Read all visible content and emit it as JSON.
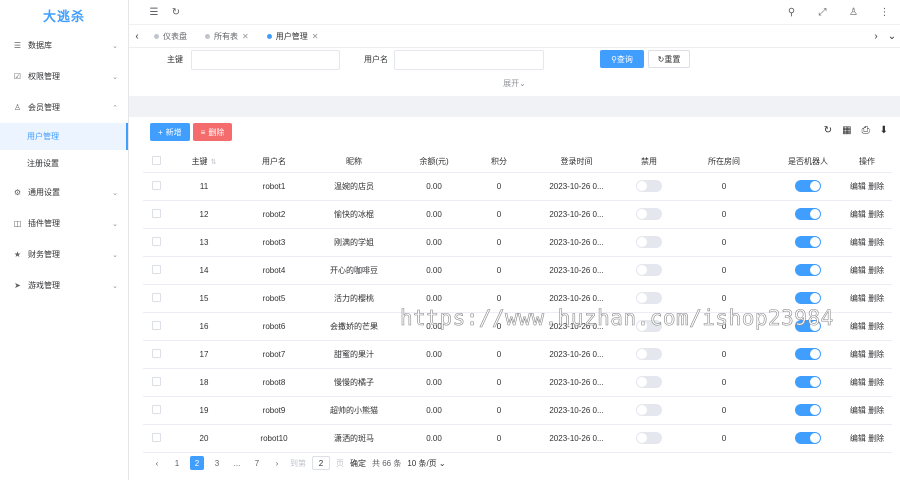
{
  "sidebar": {
    "logo": "大逃杀",
    "items": [
      {
        "label": "数据库",
        "icon": "database-icon"
      },
      {
        "label": "权限管理",
        "icon": "shield-icon"
      },
      {
        "label": "会员管理",
        "icon": "user-icon"
      },
      {
        "label": "用户管理",
        "icon": ""
      },
      {
        "label": "注册设置",
        "icon": ""
      },
      {
        "label": "通用设置",
        "icon": "gear-icon"
      },
      {
        "label": "插件管理",
        "icon": "plugin-icon"
      },
      {
        "label": "财务管理",
        "icon": "finance-icon"
      },
      {
        "label": "游戏管理",
        "icon": "send-icon"
      }
    ]
  },
  "tabs": [
    {
      "label": "仪表盘"
    },
    {
      "label": "所有表"
    },
    {
      "label": "用户管理"
    }
  ],
  "search": {
    "pk_label": "主键",
    "username_label": "用户名",
    "query_btn": "查询",
    "reset_btn": "重置",
    "expand": "展开"
  },
  "toolbar": {
    "add": "新增",
    "delete": "删除"
  },
  "table": {
    "headers": [
      "主键",
      "用户名",
      "昵称",
      "余额(元)",
      "积分",
      "登录时间",
      "禁用",
      "所在房间",
      "是否机器人",
      "操作"
    ],
    "rows": [
      {
        "id": "11",
        "username": "robot1",
        "nickname": "温婉的店员",
        "balance": "0.00",
        "points": "0",
        "login": "2023-10-26 0...",
        "room": "0"
      },
      {
        "id": "12",
        "username": "robot2",
        "nickname": "愉快的冰棍",
        "balance": "0.00",
        "points": "0",
        "login": "2023-10-26 0...",
        "room": "0"
      },
      {
        "id": "13",
        "username": "robot3",
        "nickname": "刚满的学姐",
        "balance": "0.00",
        "points": "0",
        "login": "2023-10-26 0...",
        "room": "0"
      },
      {
        "id": "14",
        "username": "robot4",
        "nickname": "开心的咖啡豆",
        "balance": "0.00",
        "points": "0",
        "login": "2023-10-26 0...",
        "room": "0"
      },
      {
        "id": "15",
        "username": "robot5",
        "nickname": "活力的樱桃",
        "balance": "0.00",
        "points": "0",
        "login": "2023-10-26 0...",
        "room": "0"
      },
      {
        "id": "16",
        "username": "robot6",
        "nickname": "会撒娇的芒果",
        "balance": "0.00",
        "points": "0",
        "login": "2023-10-26 0...",
        "room": "0"
      },
      {
        "id": "17",
        "username": "robot7",
        "nickname": "甜蜜的果汁",
        "balance": "0.00",
        "points": "0",
        "login": "2023-10-26 0...",
        "room": "0"
      },
      {
        "id": "18",
        "username": "robot8",
        "nickname": "慢慢的橘子",
        "balance": "0.00",
        "points": "0",
        "login": "2023-10-26 0...",
        "room": "0"
      },
      {
        "id": "19",
        "username": "robot9",
        "nickname": "超帅的小熊猫",
        "balance": "0.00",
        "points": "0",
        "login": "2023-10-26 0...",
        "room": "0"
      },
      {
        "id": "20",
        "username": "robot10",
        "nickname": "潇洒的斑马",
        "balance": "0.00",
        "points": "0",
        "login": "2023-10-26 0...",
        "room": "0"
      }
    ],
    "edit": "编辑",
    "delete": "删除"
  },
  "pager": {
    "pages": [
      "1",
      "2",
      "3",
      "...",
      "7"
    ],
    "goto": "到第",
    "page_value": "2",
    "page_unit": "页",
    "confirm": "确定",
    "total": "共 66 条",
    "size": "10 条/页"
  },
  "watermark": "https://www.huzhan.com/ishop23984",
  "colors": {
    "primary": "#409eff",
    "danger": "#f56c6c"
  }
}
